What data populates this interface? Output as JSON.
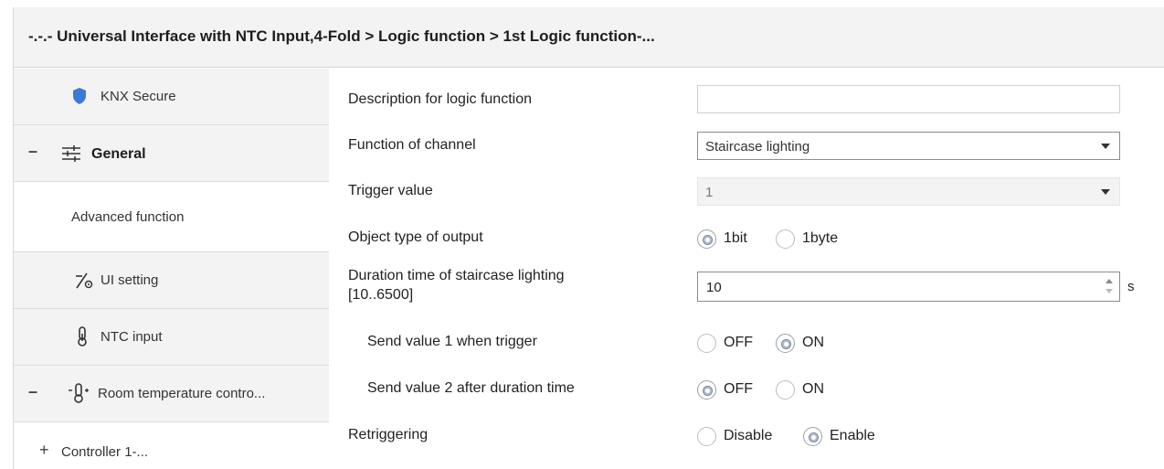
{
  "header": {
    "title": "-.-.- Universal Interface with NTC Input,4-Fold > Logic function > 1st Logic function-..."
  },
  "sidebar": {
    "items": [
      {
        "label": "KNX Secure",
        "icon": "shield-icon"
      },
      {
        "label": "General",
        "icon": "sliders-icon",
        "toggle": "–"
      },
      {
        "label": "Advanced function"
      },
      {
        "label": "UI setting",
        "icon": "ui-setting-icon"
      },
      {
        "label": "NTC input",
        "icon": "thermometer-icon"
      },
      {
        "label": "Room temperature contro...",
        "icon": "room-thermometer-icon",
        "toggle": "–"
      },
      {
        "label": "Controller 1-...",
        "toggle": "+"
      }
    ]
  },
  "form": {
    "description": {
      "label": "Description for logic function",
      "value": ""
    },
    "function_of_channel": {
      "label": "Function of channel",
      "value": "Staircase lighting"
    },
    "trigger_value": {
      "label": "Trigger value",
      "value": "1"
    },
    "object_type": {
      "label": "Object type of  output",
      "options": [
        "1bit",
        "1byte"
      ],
      "selected": "1bit"
    },
    "duration": {
      "label_line1": "Duration time of staircase lighting",
      "label_line2": "[10..6500]",
      "value": "10",
      "unit": "s"
    },
    "send_value_1": {
      "label": "Send value 1 when trigger",
      "options": [
        "OFF",
        "ON"
      ],
      "selected": "ON"
    },
    "send_value_2": {
      "label": "Send value 2 after duration time",
      "options": [
        "OFF",
        "ON"
      ],
      "selected": "OFF"
    },
    "retriggering": {
      "label": "Retriggering",
      "options": [
        "Disable",
        "Enable"
      ],
      "selected": "Enable"
    }
  },
  "colors": {
    "header_bg": "#f3f3f3",
    "sidebar_bg": "#f3f3f3",
    "shield": "#3a7bd5"
  }
}
